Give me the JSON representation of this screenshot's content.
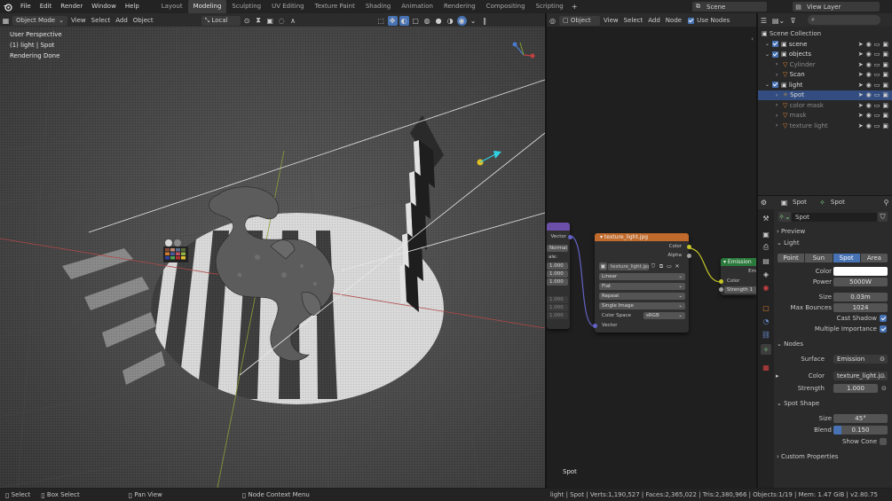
{
  "topbar": {
    "menus": [
      "File",
      "Edit",
      "Render",
      "Window",
      "Help"
    ],
    "workspaces": [
      "Layout",
      "Modeling",
      "Sculpting",
      "UV Editing",
      "Texture Paint",
      "Shading",
      "Animation",
      "Rendering",
      "Compositing",
      "Scripting"
    ],
    "active_workspace": "Modeling",
    "scene_name": "Scene",
    "view_layer": "View Layer"
  },
  "viewport": {
    "mode": "Object Mode",
    "menus": [
      "View",
      "Select",
      "Add",
      "Object"
    ],
    "orientation": "Local",
    "overlay_lines": [
      "User Perspective",
      "(1) light | Spot",
      "Rendering Done"
    ]
  },
  "node_editor": {
    "type": "Object",
    "menus": [
      "View",
      "Select",
      "Add",
      "Node"
    ],
    "use_nodes_label": "Use Nodes",
    "texture_node": {
      "title": "texture_light.jpg",
      "outputs": [
        "Color",
        "Alpha"
      ],
      "image": "texture_light.jpg",
      "interpolation": "Linear",
      "projection": "Flat",
      "extension": "Repeat",
      "source": "Single Image",
      "color_space_label": "Color Space",
      "color_space": "sRGB",
      "input": "Vector"
    },
    "mapping_node": {
      "output": "Vector",
      "type": "Normal",
      "scale_label": "ale:",
      "values_a": [
        "1.000",
        "1.000",
        "1.000"
      ],
      "values_b": [
        "1.000",
        "1.000",
        "1.000"
      ]
    },
    "emission_node": {
      "title": "Emission",
      "output": "Em",
      "color_label": "Color",
      "strength_label": "Strength",
      "strength": "1"
    },
    "footer_label": "Spot"
  },
  "outliner": {
    "root": "Scene Collection",
    "items": [
      {
        "name": "scene",
        "level": 1,
        "kind": "collection"
      },
      {
        "name": "objects",
        "level": 1,
        "kind": "collection"
      },
      {
        "name": "Cylinder",
        "level": 2,
        "kind": "object",
        "dim": true
      },
      {
        "name": "Scan",
        "level": 2,
        "kind": "object",
        "dim": false
      },
      {
        "name": "light",
        "level": 1,
        "kind": "collection"
      },
      {
        "name": "Spot",
        "level": 2,
        "kind": "light",
        "selected": true
      },
      {
        "name": "color mask",
        "level": 2,
        "kind": "object",
        "dim": true
      },
      {
        "name": "mask",
        "level": 2,
        "kind": "object",
        "dim": true
      },
      {
        "name": "texture light",
        "level": 2,
        "kind": "object",
        "dim": true
      }
    ]
  },
  "properties": {
    "object_name": "Spot",
    "data_name": "Spot",
    "datablock": "Spot",
    "preview_label": "Preview",
    "light_label": "Light",
    "light_types": [
      "Point",
      "Sun",
      "Spot",
      "Area"
    ],
    "active_light_type": "Spot",
    "color_label": "Color",
    "color_value": "#ffffff",
    "power_label": "Power",
    "power": "5000W",
    "size_label": "Size",
    "size": "0.03m",
    "max_bounces_label": "Max Bounces",
    "max_bounces": "1024",
    "cast_shadow_label": "Cast Shadow",
    "multiple_importance_label": "Multiple Importance",
    "nodes_label": "Nodes",
    "surface_label": "Surface",
    "surface": "Emission",
    "node_color_label": "Color",
    "node_color": "texture_light.j...",
    "strength_label": "Strength",
    "strength": "1.000",
    "spot_shape_label": "Spot Shape",
    "spot_size_label": "Size",
    "spot_size": "45°",
    "blend_label": "Blend",
    "blend": "0.150",
    "blend_fraction": 0.15,
    "show_cone_label": "Show Cone",
    "custom_props_label": "Custom Properties"
  },
  "statusbar": {
    "select": "Select",
    "box_select": "Box Select",
    "pan_view": "Pan View",
    "node_context": "Node Context Menu",
    "stats": "light | Spot | Verts:1,190,527 | Faces:2,365,022 | Tris:2,380,966 | Objects:1/19 | Mem: 1.47 GiB | v2.80.75"
  },
  "colors": {
    "accent": "#4772b3",
    "texture_header": "#c06a2b",
    "emission_header": "#2b7a3b",
    "mapping_header": "#6b4fa8",
    "selected_row": "#334d80"
  }
}
